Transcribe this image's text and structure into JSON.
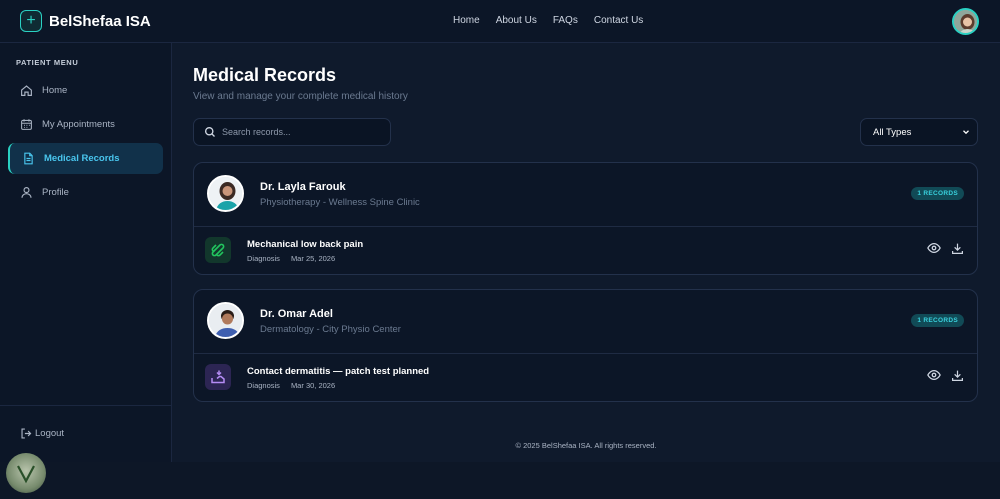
{
  "brand": {
    "name": "BelShefaa ISA",
    "logo_icon": "plus-icon",
    "accent": "#2ad1c3"
  },
  "nav": {
    "items": [
      "Home",
      "About Us",
      "FAQs",
      "Contact Us"
    ]
  },
  "sidebar": {
    "title": "PATIENT MENU",
    "items": [
      {
        "label": "Home",
        "icon": "home-icon"
      },
      {
        "label": "My Appointments",
        "icon": "calendar-icon"
      },
      {
        "label": "Medical Records",
        "icon": "document-icon",
        "active": true
      },
      {
        "label": "Profile",
        "icon": "user-icon"
      }
    ],
    "logout": "Logout"
  },
  "main": {
    "title": "Medical Records",
    "subtitle": "View and manage your complete medical history",
    "search_placeholder": "Search records...",
    "filter_value": "All Types"
  },
  "records": [
    {
      "doctor": "Dr. Layla Farouk",
      "specialty": "Physiotherapy - Wellness Spine Clinic",
      "badge": "1 RECORDS",
      "entry": {
        "title": "Mechanical low back pain",
        "type": "Diagnosis",
        "date": "Mar 25, 2026",
        "icon": "bandage-icon",
        "icon_color": "#22c55e",
        "icon_bg": "#12372c"
      }
    },
    {
      "doctor": "Dr. Omar Adel",
      "specialty": "Dermatology - City Physio Center",
      "badge": "1 RECORDS",
      "entry": {
        "title": "Contact dermatitis — patch test planned",
        "type": "Diagnosis",
        "date": "Mar 30, 2026",
        "icon": "hand-icon",
        "icon_color": "#b58cf5",
        "icon_bg": "#2c2553"
      }
    }
  ],
  "footer": "© 2025 BelShefaa ISA. All rights reserved."
}
